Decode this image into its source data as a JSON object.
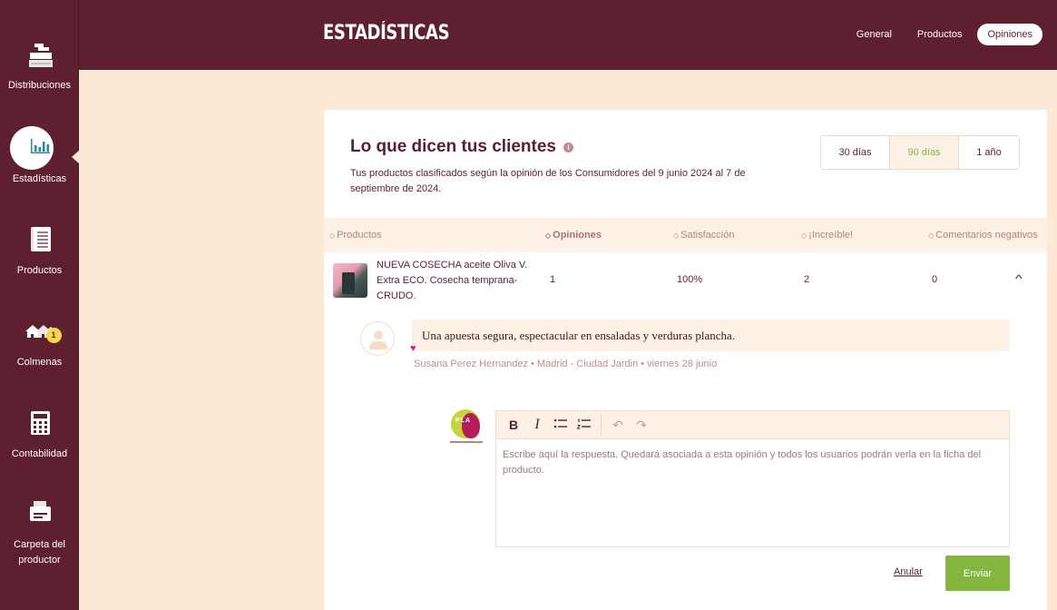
{
  "sidebar": {
    "items": [
      {
        "label": "Distribuciones",
        "icon": "boxes-icon"
      },
      {
        "label": "Estadísticas",
        "icon": "bar-chart-icon",
        "active": true
      },
      {
        "label": "Productos",
        "icon": "notebook-icon"
      },
      {
        "label": "Colmenas",
        "icon": "hives-icon",
        "badge": "1"
      },
      {
        "label": "Contabilidad",
        "icon": "calculator-icon"
      },
      {
        "label": "Carpeta del productor",
        "icon": "folder-icon"
      }
    ]
  },
  "header": {
    "title": "ESTADÍSTICAS",
    "tabs": [
      {
        "label": "General"
      },
      {
        "label": "Productos"
      },
      {
        "label": "Opiniones",
        "active": true
      }
    ]
  },
  "card": {
    "title": "Lo que dicen tus clientes",
    "info_glyph": "i",
    "subtitle": "Tus productos clasificados según la opinión de los Consumidores del 9 junio 2024 al 7 de septiembre de 2024.",
    "periods": [
      {
        "label": "30 días"
      },
      {
        "label": "90 días",
        "selected": true
      },
      {
        "label": "1 año"
      }
    ]
  },
  "table": {
    "columns": [
      "Productos",
      "Opiniones",
      "Satisfacción",
      "¡Increíble!",
      "Comentarios negativos"
    ],
    "sort_glyph": "◇",
    "rows": [
      {
        "product": "NUEVA COSECHA aceite Oliva V. Extra ECO. Cosecha temprana-CRUDO.",
        "opiniones": "1",
        "satisfaccion": "100%",
        "increible": "2",
        "negativos": "0",
        "expanded": true
      }
    ]
  },
  "review": {
    "text": "Una apuesta segura, espectacular en ensaladas y verduras plancha.",
    "meta": "Susana Perez Hernandez • Madrid - Ciudad Jardin • viernes 28 junio",
    "heart": "♥"
  },
  "reply": {
    "logo_text": "PLA",
    "toolbar": {
      "bold": "B",
      "italic": "I",
      "bullet_list": "☰",
      "numbered_list": "☰",
      "undo": "↶",
      "redo": "↷"
    },
    "placeholder": "Escribe aquí la respuesta. Quedará asociada a esta opinión y todos los usuarios podrán verla en la ficha del producto.",
    "value": "",
    "cancel_label": "Anular",
    "send_label": "Enviar"
  },
  "colors": {
    "primary": "#5e1f2e",
    "background": "#fde9d6",
    "accent_green": "#84b53e",
    "badge_yellow": "#f7d64a",
    "heart_pink": "#d02a63"
  }
}
